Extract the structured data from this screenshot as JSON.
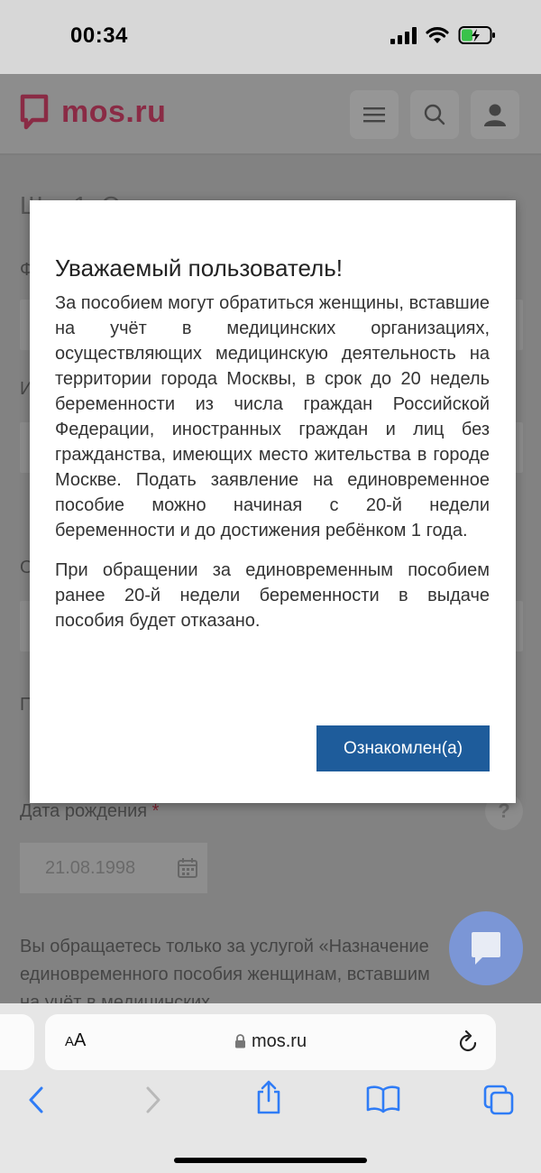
{
  "status_bar": {
    "time": "00:34"
  },
  "header": {
    "logo_text": "mos.ru"
  },
  "background": {
    "step_title": "Шаг 1. Сведения о заявителе",
    "labels": [
      "Ф",
      "И",
      "О",
      "П"
    ],
    "birth_date_label": "Дата рождения",
    "required_mark": "*",
    "birth_date_value": "21.08.1998",
    "help_mark": "?",
    "info_text": "Вы обращаетесь только за услугой «Назначение единовременного пособия женщинам, вставшим на учёт в медицинских"
  },
  "modal": {
    "title": "Уважаемый пользователь!",
    "paragraph_1": "За пособием могут обратиться женщины, вставшие на учёт в медицинских организациях, осуществляющих медицинскую деятельность на территории города Москвы, в срок до 20 недель беременности из числа граждан Российской Федерации, иностранных граждан и лиц без гражданства, имеющих место жительства в городе Москве. Подать заявление на единовременное пособие можно начиная с 20-й недели беременности и до достижения ребёнком 1 года.",
    "paragraph_2": "При обращении за единовременным пособием ранее 20-й недели беременности в выдаче пособия будет отказано.",
    "button_label": "Ознакомлен(а)"
  },
  "browser": {
    "text_size_big": "A",
    "text_size_small": "A",
    "url": "mos.ru"
  },
  "colors": {
    "accent_button": "#1e5c9b",
    "logo": "#c2334e",
    "chat_fab": "#7b96d6"
  }
}
